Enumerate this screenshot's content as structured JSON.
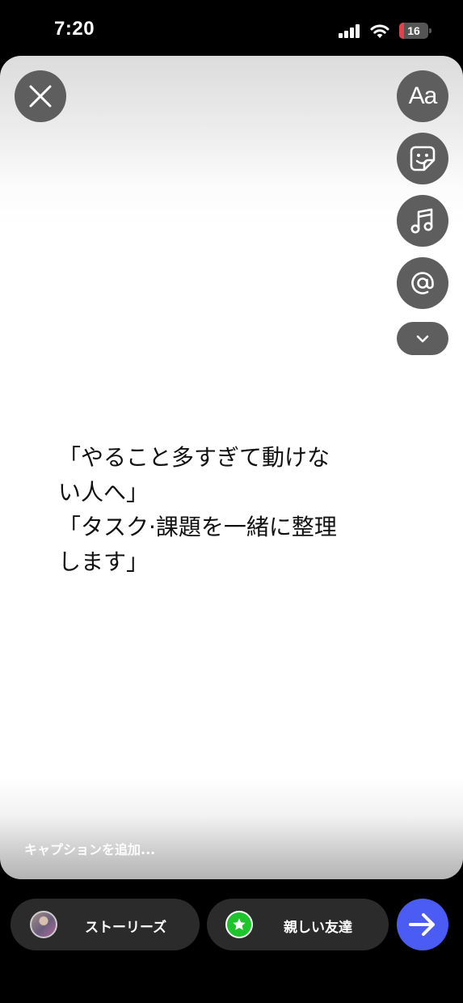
{
  "status_bar": {
    "time": "7:20",
    "battery_level": "16",
    "battery_color": "#e0424a",
    "icons": [
      "signal-icon",
      "wifi-icon",
      "battery-icon"
    ]
  },
  "editor": {
    "tools": [
      "close-icon",
      "text-aa-icon",
      "sticker-icon",
      "music-icon",
      "mention-icon",
      "chevron-down-icon"
    ],
    "text_tool_label": "Aa",
    "story_text_lines": [
      "「やること多すぎて動けな",
      "い人へ」",
      "「タスク·課題を一緒に整理",
      "します」"
    ],
    "caption_placeholder": "キャプションを追加..."
  },
  "share_bar": {
    "stories_label": "ストーリーズ",
    "close_friends_label": "親しい友達",
    "close_friends_color": "#1ec42b",
    "send_color": "#4a5cf3"
  }
}
